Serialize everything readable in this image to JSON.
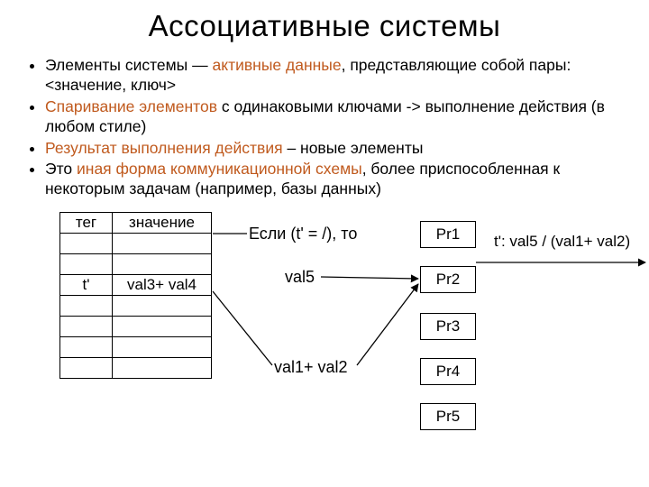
{
  "title": "Ассоциативные системы",
  "bullets": {
    "b1_pre": "Элементы системы — ",
    "b1_hi": "активные данные",
    "b1_post": ", представляющие собой пары: <значение, ключ>",
    "b2_hi": "Спаривание элементов",
    "b2_post": " с одинаковыми ключами -> выполнение действия (в любом стиле)",
    "b3_hi": "Результат выполнения действия",
    "b3_post": " – новые элементы",
    "b4_pre": "Это ",
    "b4_hi": "иная форма коммуникационной схемы",
    "b4_post": ", более приспособленная к некоторым задачам (например, базы данных)"
  },
  "table": {
    "headers": {
      "tag": "тег",
      "value": "значение"
    },
    "rows": [
      {
        "tag": "",
        "value": ""
      },
      {
        "tag": "",
        "value": ""
      },
      {
        "tag": "t'",
        "value": "val3+ val4"
      },
      {
        "tag": "",
        "value": ""
      },
      {
        "tag": "",
        "value": ""
      },
      {
        "tag": "",
        "value": ""
      },
      {
        "tag": "",
        "value": ""
      }
    ]
  },
  "labels": {
    "condition": "Если (t' = /), то",
    "val5": "val5",
    "val12": "val1+ val2",
    "out_line1": "t': val5 / (val1+ val2)",
    "out_dots": "…"
  },
  "processors": {
    "p1": "Pr1",
    "p2": "Pr2",
    "p3": "Pr3",
    "p4": "Pr4",
    "p5": "Pr5"
  }
}
